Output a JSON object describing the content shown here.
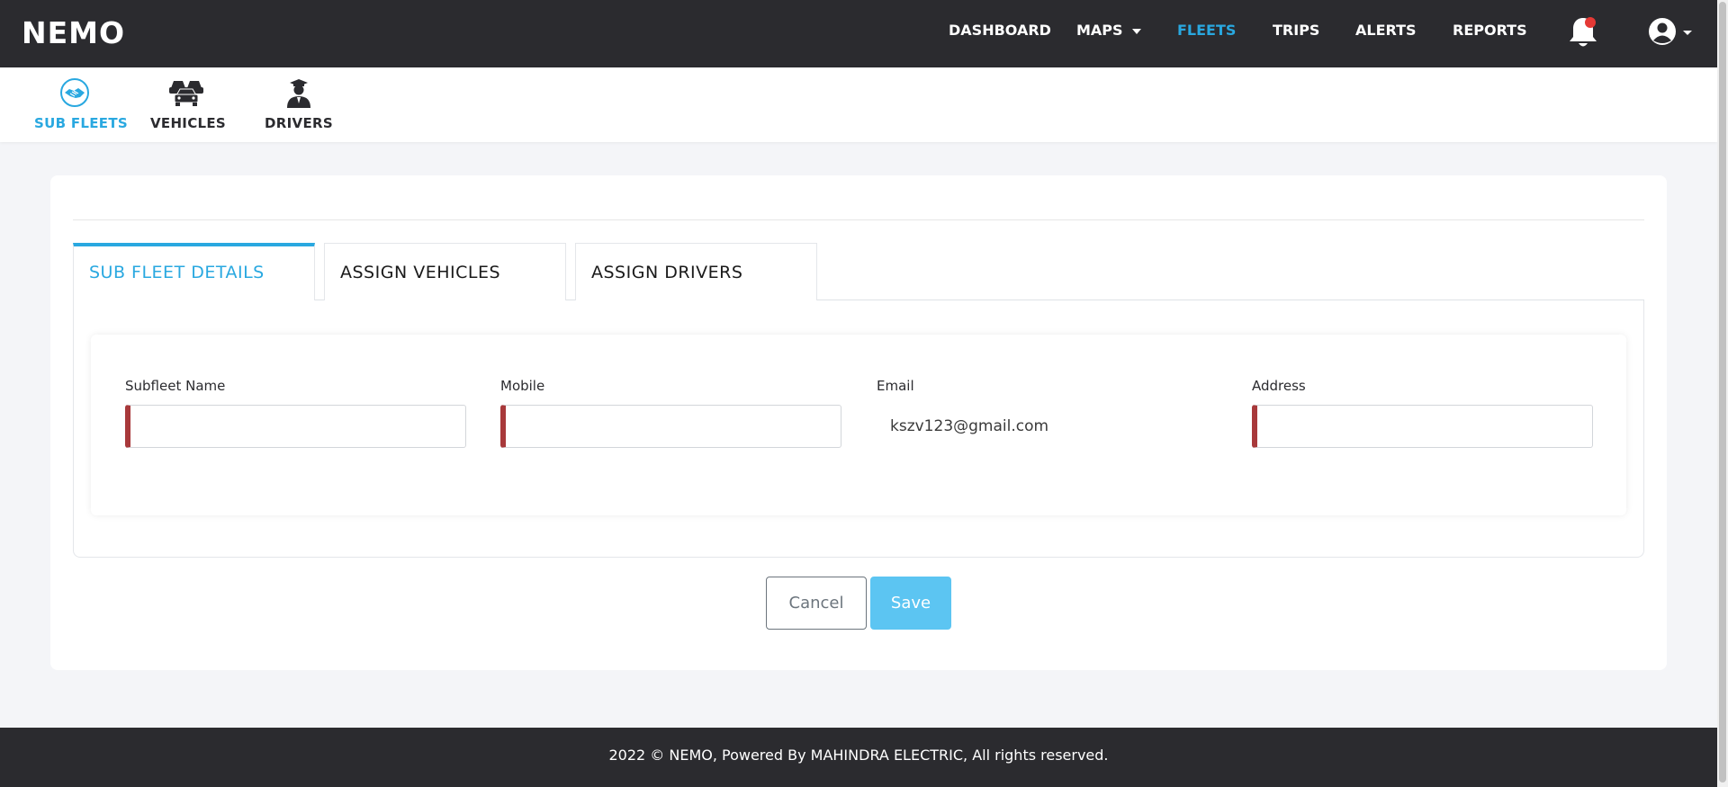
{
  "brand": {
    "logo": "NEMO"
  },
  "nav": {
    "dashboard": "DASHBOARD",
    "maps": "MAPS",
    "fleets": "FLEETS",
    "trips": "TRIPS",
    "alerts": "ALERTS",
    "reports": "REPORTS",
    "bell_icon": "bell-icon",
    "user_icon": "user-circle-icon",
    "active": "FLEETS"
  },
  "subnav": {
    "items": [
      {
        "label": "SUB FLEETS",
        "icon": "handshake-icon",
        "active": true
      },
      {
        "label": "VEHICLES",
        "icon": "cars-icon",
        "active": false
      },
      {
        "label": "DRIVERS",
        "icon": "driver-icon",
        "active": false
      }
    ]
  },
  "tabs": [
    {
      "label": "SUB FLEET DETAILS",
      "active": true
    },
    {
      "label": "ASSIGN VEHICLES",
      "active": false
    },
    {
      "label": "ASSIGN DRIVERS",
      "active": false
    }
  ],
  "form": {
    "subfleet_name": {
      "label": "Subfleet Name",
      "value": ""
    },
    "mobile": {
      "label": "Mobile",
      "value": ""
    },
    "email": {
      "label": "Email",
      "value": "kszv123@gmail.com"
    },
    "address": {
      "label": "Address",
      "value": ""
    }
  },
  "buttons": {
    "cancel": "Cancel",
    "save": "Save"
  },
  "footer": {
    "text": "2022 © NEMO, Powered By MAHINDRA ELECTRIC, All rights reserved."
  },
  "colors": {
    "accent": "#29a8e0",
    "topbar": "#2b2b2f",
    "required": "#a8393b",
    "save": "#5cc5f2",
    "notification": "#e53935"
  }
}
